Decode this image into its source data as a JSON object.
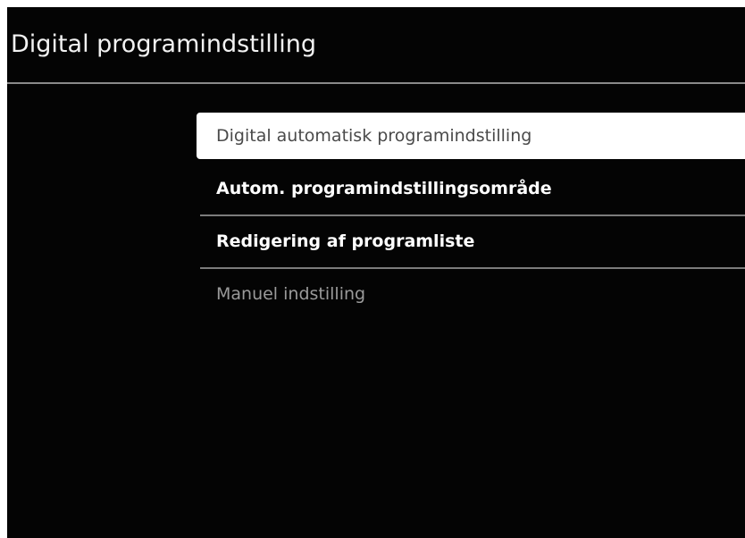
{
  "screen": {
    "title": "Digital programindstilling"
  },
  "menu": {
    "items": [
      {
        "label": "Digital automatisk programindstilling",
        "state": "selected"
      },
      {
        "label": "Autom. programindstillingsområde",
        "state": "normal"
      },
      {
        "label": "Redigering af programliste",
        "state": "normal"
      },
      {
        "label": "Manuel indstilling",
        "state": "disabled"
      }
    ]
  },
  "colors": {
    "background": "#040404",
    "text": "#ffffff",
    "selected_background": "#ffffff",
    "selected_text": "#4a4a4a",
    "disabled_text": "#9a9a9a",
    "divider": "#7c7c7c"
  }
}
